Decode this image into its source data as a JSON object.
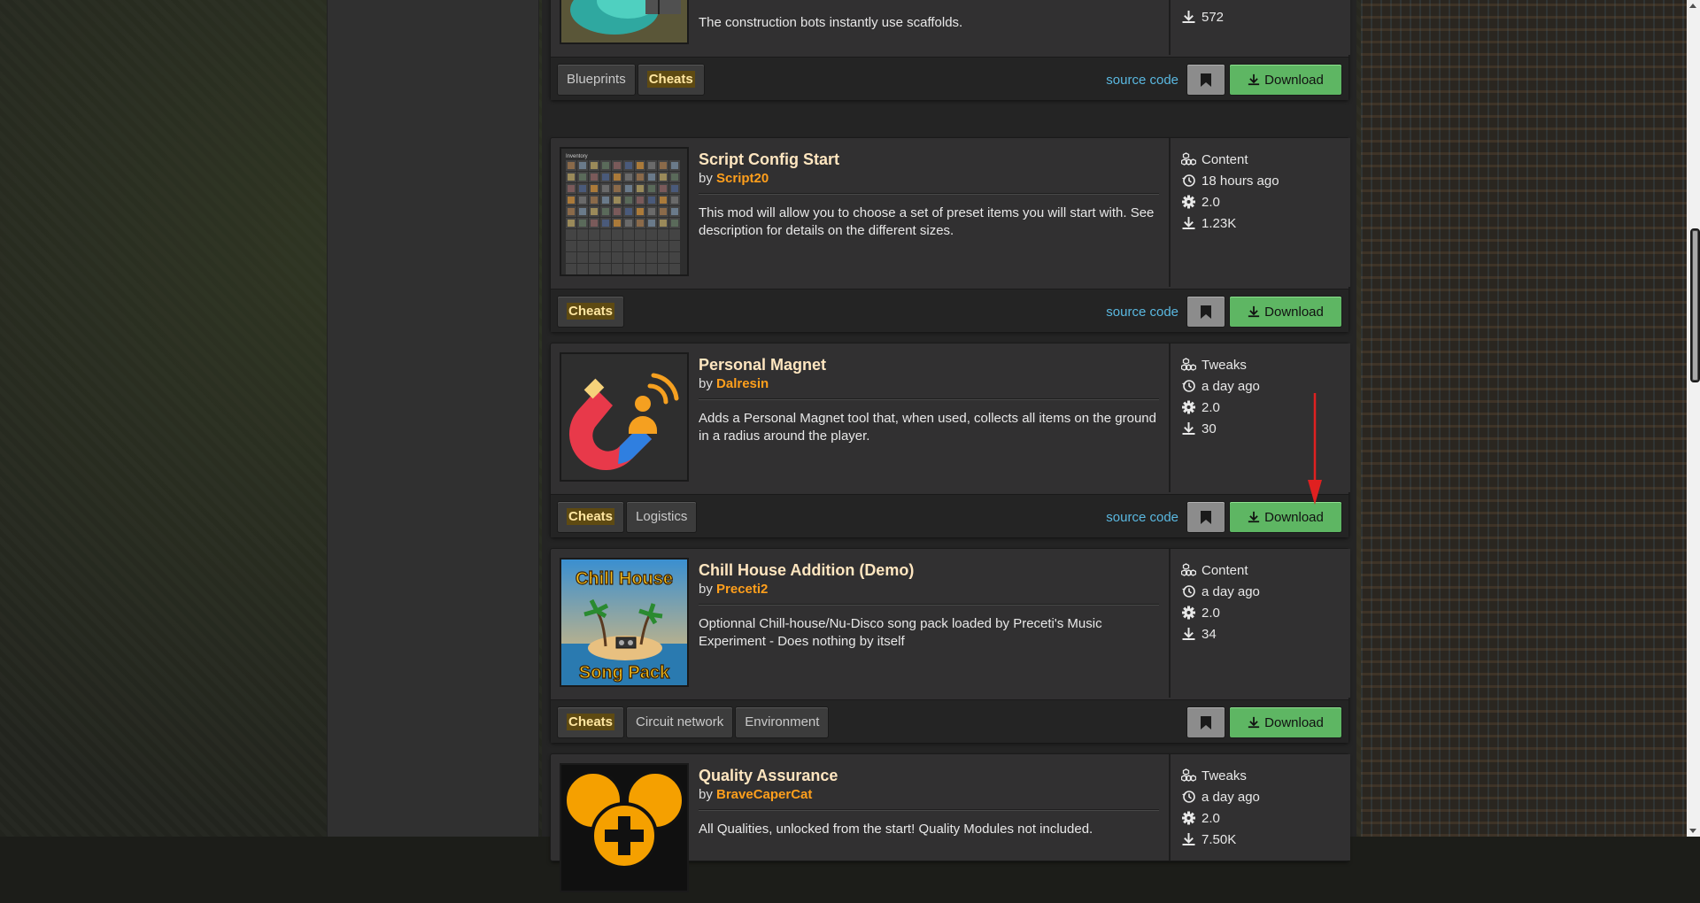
{
  "cards": [
    {
      "summary": "The construction bots instantly use scaffolds.",
      "downloads": "572",
      "tags": [
        "Blueprints",
        "Cheats"
      ],
      "source_label": "source code",
      "download_label": "Download"
    },
    {
      "title": "Script Config Start",
      "by": "by",
      "author": "Script20",
      "summary": "This mod will allow you to choose a set of preset items you will start with. See description for details on the different sizes.",
      "category": "Content",
      "updated": "18 hours ago",
      "version": "2.0",
      "downloads": "1.23K",
      "tags": [
        "Cheats"
      ],
      "source_label": "source code",
      "download_label": "Download"
    },
    {
      "title": "Personal Magnet",
      "by": "by",
      "author": "Dalresin",
      "summary": "Adds a Personal Magnet tool that, when used, collects all items on the ground in a radius around the player.",
      "category": "Tweaks",
      "updated": "a day ago",
      "version": "2.0",
      "downloads": "30",
      "tags": [
        "Cheats",
        "Logistics"
      ],
      "source_label": "source code",
      "download_label": "Download"
    },
    {
      "title": "Chill House Addition (Demo)",
      "by": "by",
      "author": "Preceti2",
      "summary": "Optionnal Chill-house/Nu-Disco song pack loaded by Preceti's Music Experiment - Does nothing by itself",
      "category": "Content",
      "updated": "a day ago",
      "version": "2.0",
      "downloads": "34",
      "tags": [
        "Cheats",
        "Circuit network",
        "Environment"
      ],
      "download_label": "Download",
      "thumb_text_top": "Chill House",
      "thumb_text_bottom": "Song Pack"
    },
    {
      "title": "Quality Assurance",
      "by": "by",
      "author": "BraveCaperCat",
      "summary": "All Qualities, unlocked from the start! Quality Modules not included.",
      "category": "Tweaks",
      "updated": "a day ago",
      "version": "2.0",
      "downloads": "7.50K"
    }
  ],
  "thumb_labels": {
    "inventory": "Inventory"
  },
  "colors": {
    "accent_orange": "#ff9f1c",
    "download_green": "#5eb663",
    "link_blue": "#5ab8e0",
    "annotation_red": "#e02020"
  }
}
